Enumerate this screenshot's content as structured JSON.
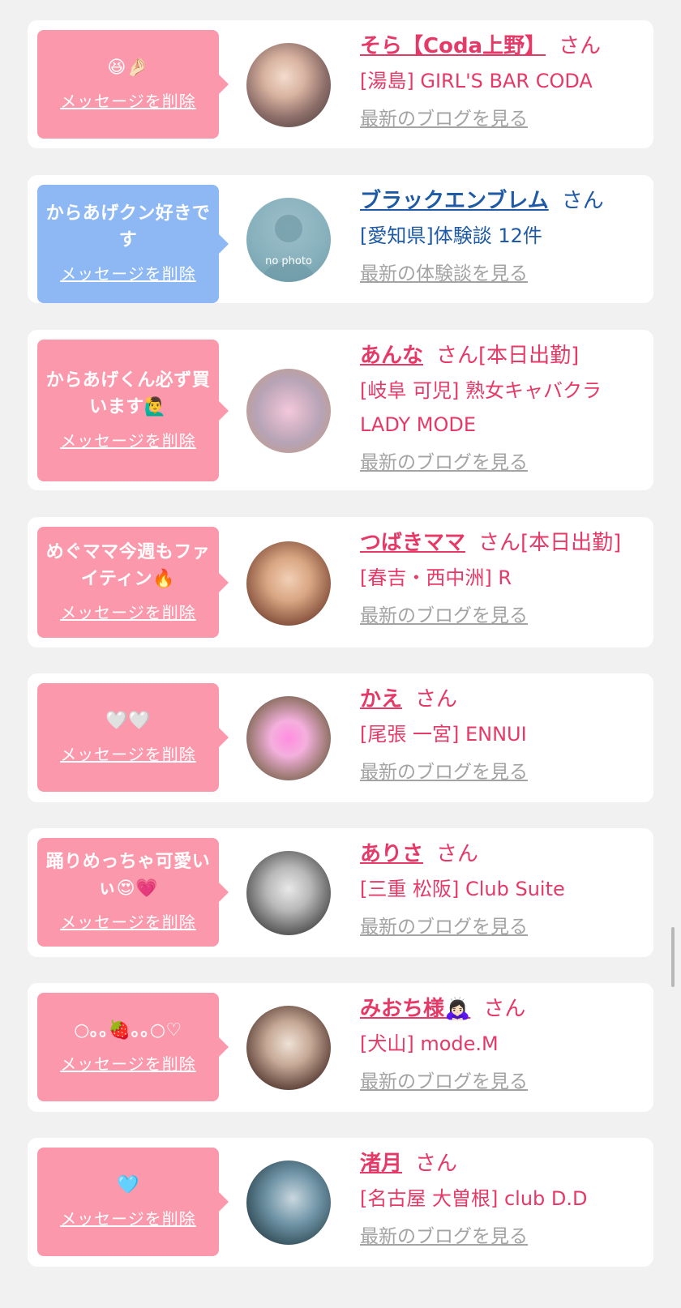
{
  "colors": {
    "background": "#f1f1f1",
    "card": "#ffffff",
    "bubble_pink": "#fb98ab",
    "bubble_blue": "#8db8f4",
    "name_pink": "#e53a68",
    "name_blue": "#1e5aa6",
    "link_gray": "#a3a3a3"
  },
  "items": [
    {
      "bubble_color": "pink",
      "message": "😆🤌🏻",
      "delete_label": "メッセージを削除",
      "avatar": "avatar-photo",
      "name": "そら【Coda上野】",
      "suffix": "さん",
      "shop": "[湯島] GIRL'S BAR CODA",
      "more_label": "最新のブログを見る",
      "text_color": "pink"
    },
    {
      "bubble_color": "blue",
      "message": "からあげクン好きです",
      "delete_label": "メッセージを削除",
      "avatar": "no-photo",
      "avatar_text": "no photo",
      "name": "ブラックエンブレム",
      "suffix": "さん",
      "shop": "[愛知県]体験談 12件",
      "more_label": "最新の体験談を見る",
      "text_color": "blue"
    },
    {
      "bubble_color": "pink",
      "message": "からあげくん必ず買います🙋‍♂️",
      "delete_label": "メッセージを削除",
      "avatar": "avatar-photo",
      "name": "あんな",
      "suffix": "さん[本日出勤]",
      "shop": "[岐阜 可児] 熟女キャバクラ LADY MODE",
      "more_label": "最新のブログを見る",
      "text_color": "pink"
    },
    {
      "bubble_color": "pink",
      "message": "めぐママ今週もファイティン🔥",
      "delete_label": "メッセージを削除",
      "avatar": "avatar-photo",
      "name": "つばきママ",
      "suffix": "さん[本日出勤]",
      "shop": "[春吉・西中洲] R",
      "more_label": "最新のブログを見る",
      "text_color": "pink"
    },
    {
      "bubble_color": "pink",
      "message": "🤍🤍",
      "delete_label": "メッセージを削除",
      "avatar": "avatar-photo",
      "name": "かえ",
      "suffix": "さん",
      "shop": "[尾張 一宮] ENNUI",
      "more_label": "最新のブログを見る",
      "text_color": "pink"
    },
    {
      "bubble_color": "pink",
      "message": "踊りめっちゃ可愛いぃ😍💗",
      "delete_label": "メッセージを削除",
      "avatar": "avatar-photo",
      "name": "ありさ",
      "suffix": "さん",
      "shop": "[三重 松阪] Club Suite",
      "more_label": "最新のブログを見る",
      "text_color": "pink"
    },
    {
      "bubble_color": "pink",
      "message": "○｡｡🍓｡｡○♡",
      "delete_label": "メッセージを削除",
      "avatar": "avatar-photo",
      "name": "みおち様🙇🏻‍♀️",
      "suffix": "さん",
      "shop": "[犬山] mode.M",
      "more_label": "最新のブログを見る",
      "text_color": "pink"
    },
    {
      "bubble_color": "pink",
      "message": "🩵",
      "delete_label": "メッセージを削除",
      "avatar": "avatar-photo",
      "name": "渚月",
      "suffix": "さん",
      "shop": "[名古屋 大曽根] club D.D",
      "more_label": "最新のブログを見る",
      "text_color": "pink"
    }
  ]
}
